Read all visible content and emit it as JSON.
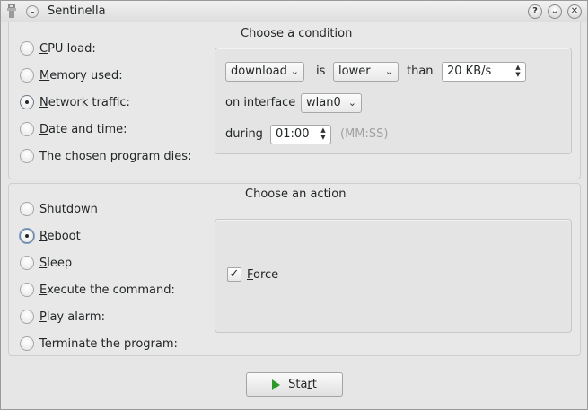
{
  "window": {
    "title": "Sentinella",
    "help_button": "?",
    "minimize_button": "⌄",
    "close_button": "✕"
  },
  "condition": {
    "section_title": "Choose a condition",
    "options": [
      {
        "mnemonic": "C",
        "rest": "PU load:",
        "checked": false
      },
      {
        "mnemonic": "M",
        "rest": "emory used:",
        "checked": false
      },
      {
        "mnemonic": "N",
        "rest": "etwork traffic:",
        "checked": true
      },
      {
        "mnemonic": "D",
        "rest": "ate and time:",
        "checked": false
      },
      {
        "mnemonic": "T",
        "rest": "he chosen program dies:",
        "checked": false
      }
    ],
    "network": {
      "direction_value": "download",
      "is_label": "is",
      "comparison_value": "lower",
      "than_label": "than",
      "rate_value": "20 KB/s",
      "interface_label": "on interface",
      "interface_value": "wlan0",
      "during_label": "during",
      "duration_value": "01:00",
      "duration_hint": "(MM:SS)"
    }
  },
  "action": {
    "section_title": "Choose an action",
    "options": [
      {
        "mnemonic": "S",
        "rest": "hutdown",
        "checked": false
      },
      {
        "mnemonic": "R",
        "rest": "eboot",
        "checked": true
      },
      {
        "mnemonic": "S",
        "rest": "leep",
        "checked": false
      },
      {
        "mnemonic": "E",
        "rest": "xecute the command:",
        "checked": false
      },
      {
        "mnemonic": "P",
        "rest": "lay alarm:",
        "checked": false
      },
      {
        "mnemonic": "",
        "rest": "Terminate the program:",
        "checked": false
      }
    ],
    "force": {
      "mnemonic": "F",
      "rest": "orce",
      "checked": true,
      "checkmark": "✓"
    }
  },
  "start": {
    "pre": "Sta",
    "mnemonic": "r",
    "post": "t",
    "icon": "play-icon",
    "icon_color": "#2b9a2b"
  }
}
